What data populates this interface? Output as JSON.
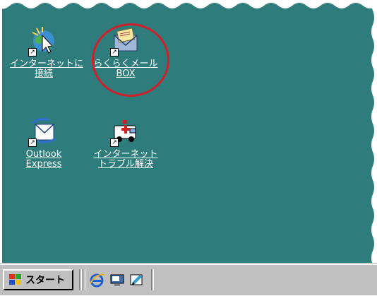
{
  "desktop": {
    "background_color": "#2e7c7c",
    "icons": [
      {
        "name": "internet-connect",
        "label_line1": "インターネットに",
        "label_line2": "接続"
      },
      {
        "name": "rakuraku-mail-box",
        "label_line1": "らくらくメール",
        "label_line2": "BOX"
      },
      {
        "name": "outlook-express",
        "label_line1": "Outlook",
        "label_line2": "Express"
      },
      {
        "name": "internet-trouble",
        "label_line1": "インターネット",
        "label_line2": "トラブル解決"
      }
    ],
    "highlight_color": "#d0202a"
  },
  "taskbar": {
    "start_label": "スタート",
    "quick_launch": [
      "internet-explorer-icon",
      "show-desktop-icon",
      "channels-icon"
    ]
  }
}
